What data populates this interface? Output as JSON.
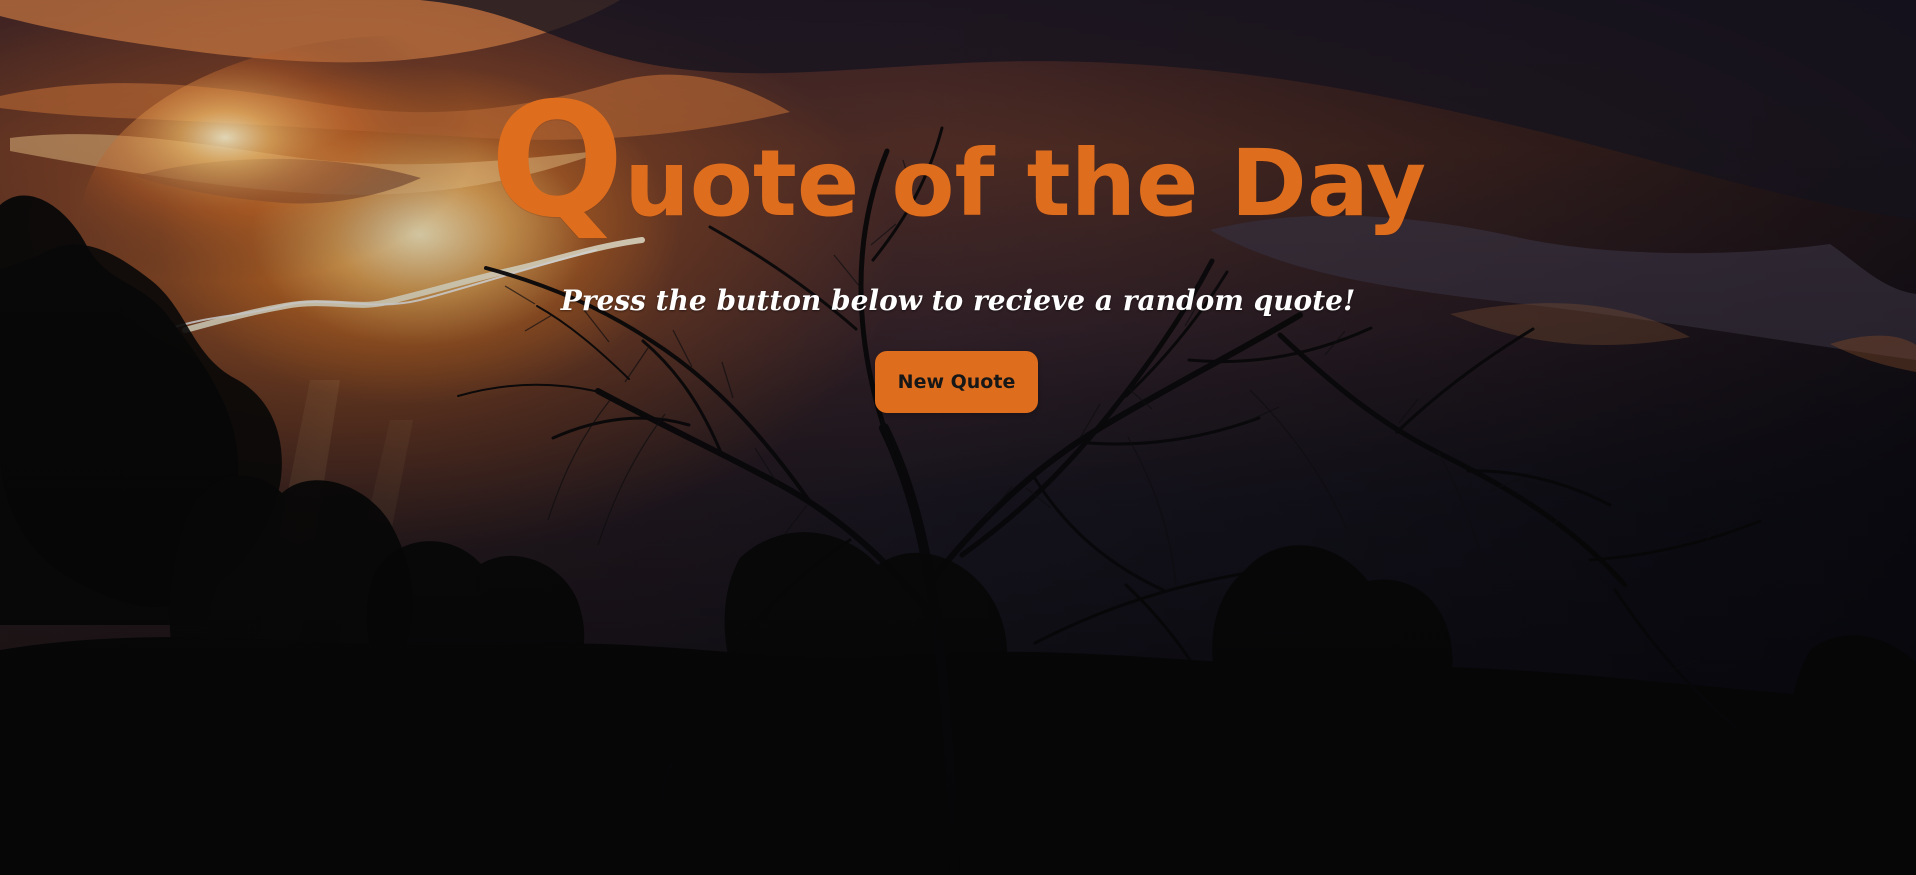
{
  "page": {
    "title_initial": "Q",
    "title_rest": "uote of the Day",
    "instruction": "Press the button below to recieve a random quote!",
    "button_label": "New Quote"
  },
  "colors": {
    "accent": "#de6e1e",
    "instruction_text": "#ffffff",
    "button_text": "#171717"
  },
  "background": {
    "image_subject": "sunset sky behind silhouetted trees"
  }
}
